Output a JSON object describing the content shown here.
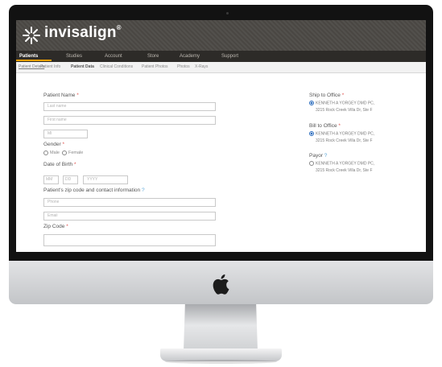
{
  "app": {
    "brand": "invisalign",
    "brand_mark": "®",
    "logo_icon": "star-burst-icon",
    "accent_color": "#f2a100"
  },
  "nav": {
    "tabs": [
      "Patients",
      "Studies",
      "Account",
      "Store",
      "Academy",
      "Support"
    ],
    "active": "Patients"
  },
  "breadcrumb": {
    "items": [
      "Patient Details",
      "Patient Info",
      "Patient Data",
      "Clinical Conditions",
      "Patient Photos",
      "Photos",
      "X-Rays"
    ],
    "active": "Patient Data"
  },
  "form": {
    "patient_name": {
      "label": "Patient Name",
      "last_name_placeholder": "Last name",
      "first_name_placeholder": "First name",
      "mi_placeholder": "MI"
    },
    "gender": {
      "label": "Gender",
      "options": [
        "Male",
        "Female"
      ]
    },
    "dob": {
      "label": "Date of Birth",
      "mm": "MM",
      "dd": "DD",
      "yyyy": "YYYY"
    },
    "contact": {
      "label": "Patient's zip code and contact information",
      "phone_placeholder": "Phone",
      "email_placeholder": "Email"
    },
    "zip": {
      "label": "Zip Code"
    }
  },
  "sidebar": {
    "ship_to_office": {
      "label": "Ship to Office",
      "line1": "KENNETH A YORGEY DMD PC,",
      "line2": "3215 Rock Creek Villa Dr, Ste F"
    },
    "bill_to_office": {
      "label": "Bill to Office",
      "line1": "KENNETH A YORGEY DMD PC,",
      "line2": "3215 Rock Creek Villa Dr, Ste F"
    },
    "payor": {
      "label": "Payor",
      "line1": "KENNETH A YORGEY DMD PC,",
      "line2": "3215 Rock Creek Villa Dr, Ste F"
    }
  },
  "device": {
    "logo_icon": "apple-logo-icon"
  }
}
